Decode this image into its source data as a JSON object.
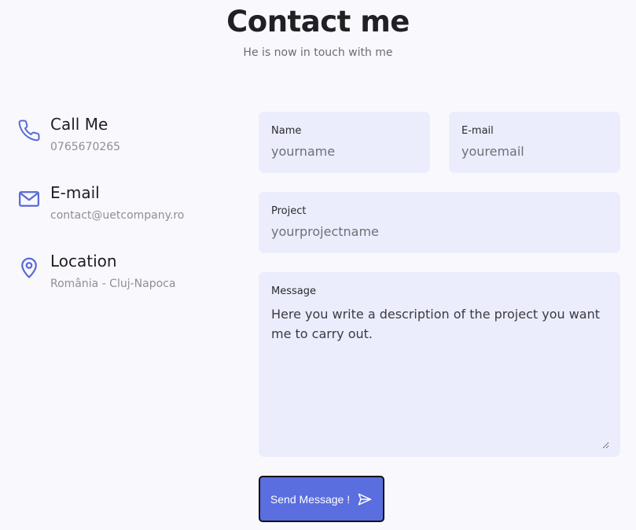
{
  "header": {
    "title": "Contact me",
    "subtitle": "He is now in touch with me"
  },
  "contact_info": [
    {
      "icon": "phone-icon",
      "title": "Call Me",
      "text": "0765670265"
    },
    {
      "icon": "mail-icon",
      "title": "E-mail",
      "text": "contact@uetcompany.ro"
    },
    {
      "icon": "location-pin-icon",
      "title": "Location",
      "text": "România - Cluj-Napoca"
    }
  ],
  "form": {
    "name_label": "Name",
    "name_placeholder": "yourname",
    "email_label": "E-mail",
    "email_placeholder": "youremail",
    "project_label": "Project",
    "project_placeholder": "yourprojectname",
    "message_label": "Message",
    "message_value": "Here you write a description of the project you want me to carry out.",
    "send_label": "Send Message !"
  },
  "colors": {
    "accent": "#5a6ee0",
    "icon": "#5a6ad8",
    "field_bg": "#ecedfc",
    "page_bg": "#f9f9fd"
  }
}
